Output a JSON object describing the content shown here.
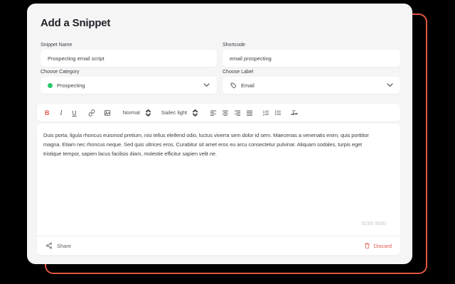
{
  "title": "Add a Snippet",
  "snippet_name": {
    "label": "Snippet Name",
    "value": "Prospecting email script"
  },
  "shortcode": {
    "label": "Shortcode",
    "value": "email prospecting"
  },
  "category": {
    "label": "Choose Category",
    "value": "Prospecting"
  },
  "label_field": {
    "label": "Choose Label",
    "value": "Email"
  },
  "toolbar": {
    "bold": "B",
    "italic": "I",
    "underline": "U",
    "style": "Normal",
    "font": "Sailec light",
    "clear_t": "T",
    "clear_x": "x"
  },
  "editor": {
    "body": "Duis porta, ligula rhoncus euismod pretium, nisi tellus eleifend odio, luctus viverra sem dolor id sem. Maecenas a venenatis enim, quis porttitor magna. Etiam nec rhoncus neque. Sed quis ultrices eros. Curabitur sit amet eros eu arcu consectetur pulvinar. Aliquam sodales, turpis eget tristique tempor, sapien lacus facilisis diam, molestie efficitur sapien velit ne.",
    "char_count": "3235/ 5000"
  },
  "footer": {
    "share": "Share",
    "discard": "Discard"
  },
  "colors": {
    "accent_red": "#E2574C",
    "category_green": "#2BC76A",
    "outline_red": "#E25740",
    "card_bg": "#F5F5F6"
  }
}
